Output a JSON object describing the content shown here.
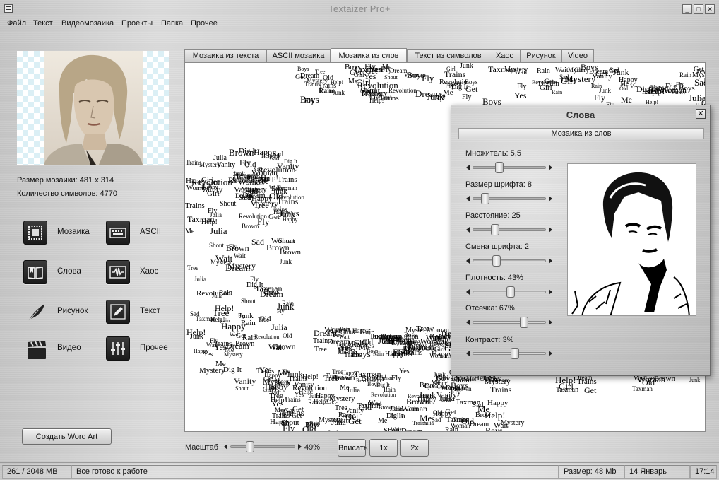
{
  "window": {
    "title": "Textaizer Pro+",
    "minimize": "_",
    "maximize": "□",
    "close": "✕"
  },
  "menu": [
    "Файл",
    "Текст",
    "Видеомозаика",
    "Проекты",
    "Папка",
    "Прочее"
  ],
  "info": {
    "mosaic_size": "Размер мозаики: 481 x 314",
    "char_count": "Количество символов: 4770"
  },
  "modes": [
    {
      "label": "Мозаика",
      "icon": "mosaic-icon"
    },
    {
      "label": "ASCII",
      "icon": "keyboard-icon"
    },
    {
      "label": "Слова",
      "icon": "book-icon"
    },
    {
      "label": "Хаос",
      "icon": "waveform-icon"
    },
    {
      "label": "Рисунок",
      "icon": "feather-icon"
    },
    {
      "label": "Текст",
      "icon": "pencil-icon"
    },
    {
      "label": "Видео",
      "icon": "clapperboard-icon"
    },
    {
      "label": "Прочее",
      "icon": "sliders-icon"
    }
  ],
  "wordart_button": "Создать Word Art",
  "tabs": [
    {
      "label": "Мозаика из текста",
      "active": false
    },
    {
      "label": "ASCII мозаика",
      "active": false
    },
    {
      "label": "Мозаика из слов",
      "active": true
    },
    {
      "label": "Текст из символов",
      "active": false
    },
    {
      "label": "Хаос",
      "active": false
    },
    {
      "label": "Рисунок",
      "active": false
    },
    {
      "label": "Video",
      "active": false
    }
  ],
  "mosaic_words": [
    "Rain",
    "Girl",
    "Wait",
    "Help!",
    "Boys",
    "Shout",
    "Junk",
    "Dig It",
    "Taxman",
    "Julia",
    "Revolution",
    "Fly",
    "Dream",
    "Get",
    "Yes",
    "Mystery",
    "Trains",
    "Woman",
    "Vanity",
    "Tree",
    "Old",
    "Brown",
    "Sad",
    "Me",
    "Happy"
  ],
  "words_panel": {
    "title": "Слова",
    "close": "✕",
    "section": "Мозаика из слов",
    "sliders": [
      {
        "label": "Множитель: 5,5",
        "value": 0.36
      },
      {
        "label": "Размер шрифта: 8",
        "value": 0.16
      },
      {
        "label": "Расстояние: 25",
        "value": 0.3
      },
      {
        "label": "Смена шрифта: 2",
        "value": 0.32
      },
      {
        "label": "Плотность: 43%",
        "value": 0.52
      },
      {
        "label": "Отсечка: 67%",
        "value": 0.71
      },
      {
        "label": "Контраст: 3%",
        "value": 0.58
      }
    ]
  },
  "zoom": {
    "label": "Масштаб",
    "value": 0.3,
    "percent": "49%"
  },
  "zoom_buttons": {
    "fit": "Вписать",
    "x1": "1x",
    "x2": "2x"
  },
  "status": {
    "memory": "261 / 2048 MB",
    "message": "Все готово к работе",
    "size": "Размер:  48 Mb",
    "date": "14 Январь 2020",
    "time": "17:14"
  }
}
